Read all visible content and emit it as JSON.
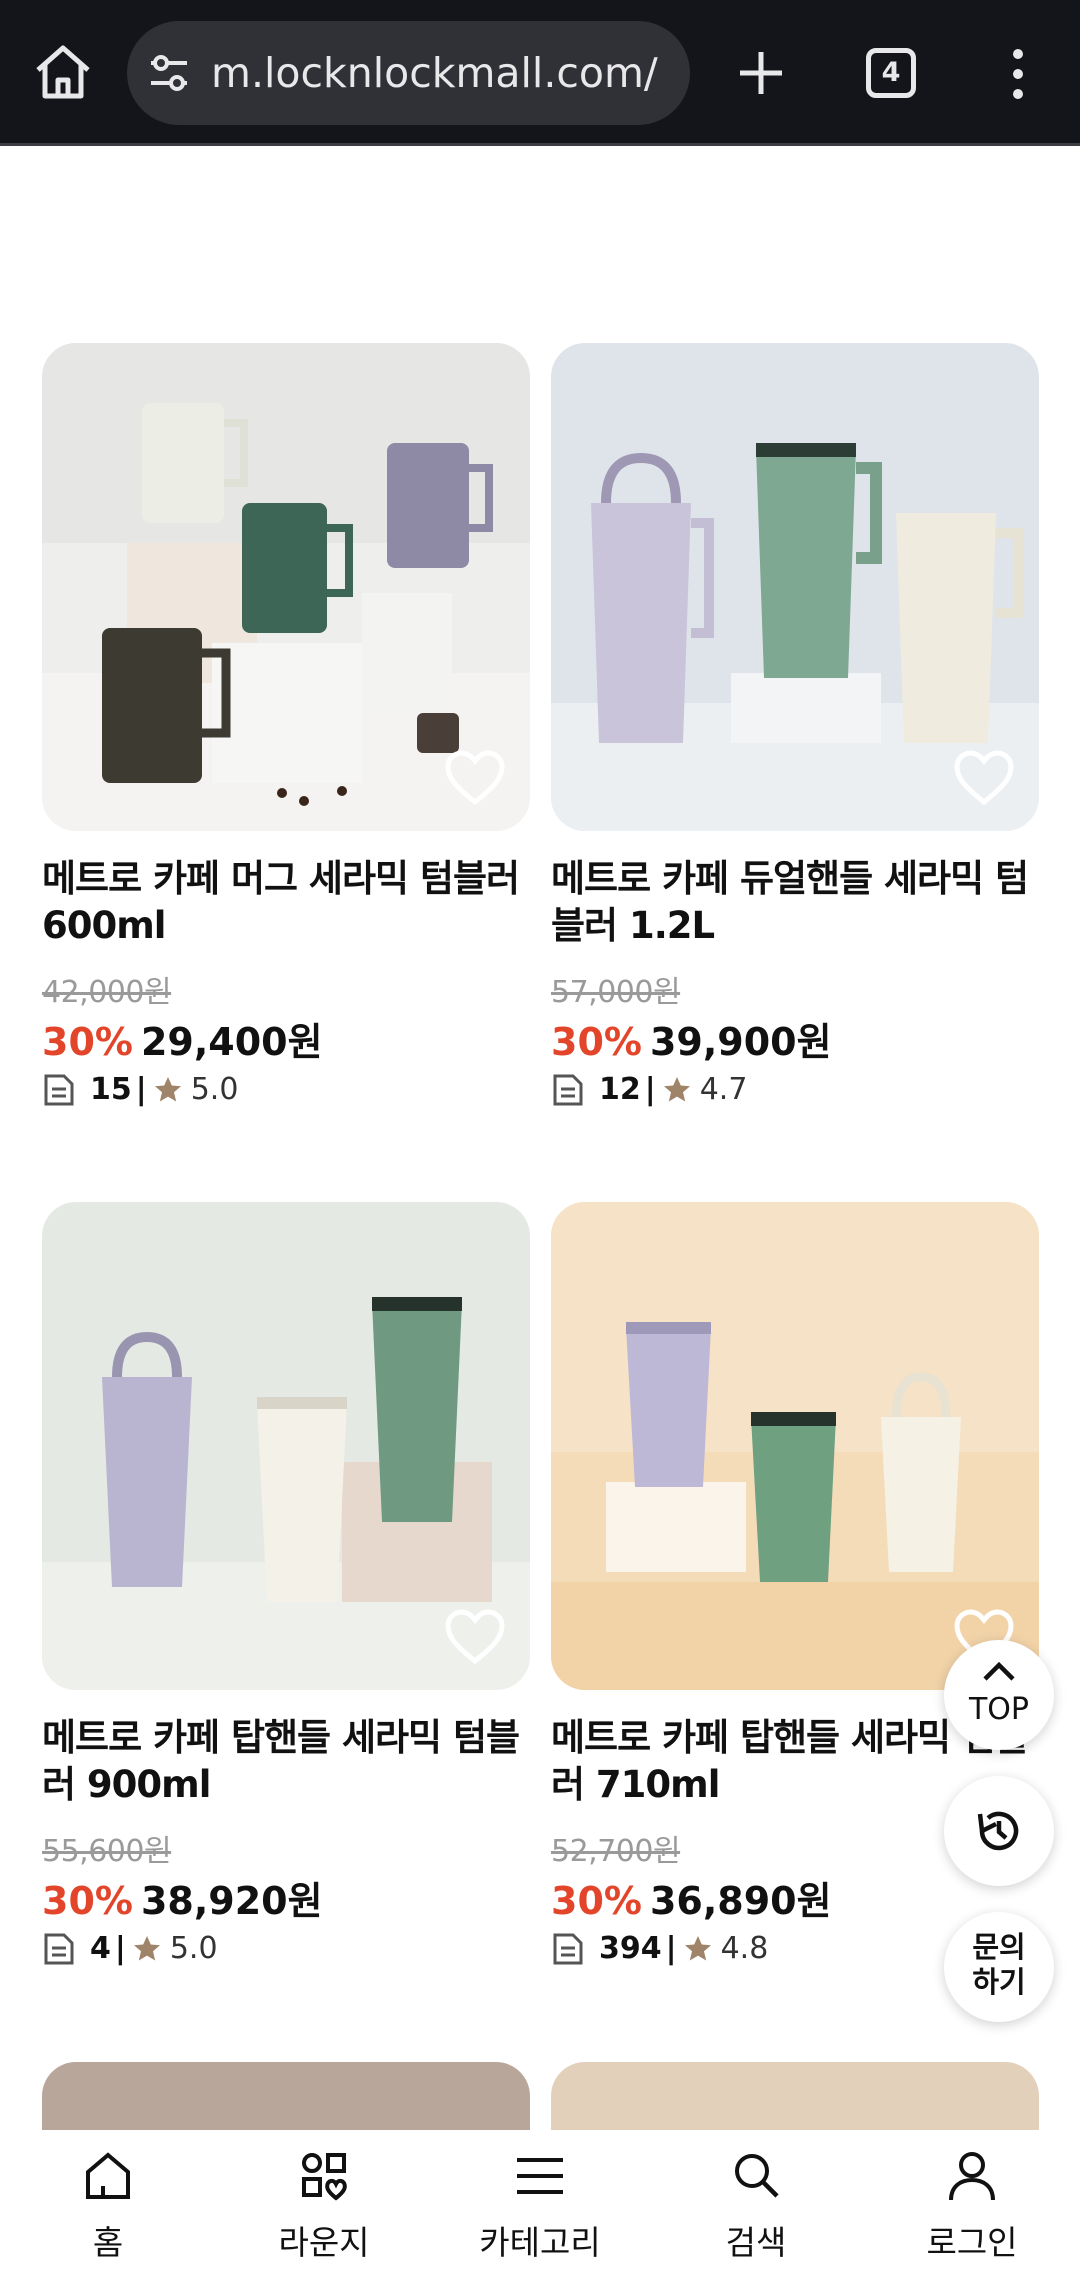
{
  "browser": {
    "url": "m.locknlockmall.com/",
    "tab_count": "4",
    "icons": [
      "home-icon",
      "tune-icon",
      "plus-icon",
      "tab-switcher-icon",
      "more-vert-icon"
    ]
  },
  "products": [
    {
      "name": "메트로 카페 머그 세라믹 텀블러 600ml",
      "original_price": "42,000원",
      "discount": "30%",
      "sale_price": "29,400원",
      "review_count": "15",
      "rating": "5.0"
    },
    {
      "name": "메트로 카페 듀얼핸들 세라믹 텀블러 1.2L",
      "original_price": "57,000원",
      "discount": "30%",
      "sale_price": "39,900원",
      "review_count": "12",
      "rating": "4.7"
    },
    {
      "name": "메트로 카페 탑핸들 세라믹 텀블러 900ml",
      "original_price": "55,600원",
      "discount": "30%",
      "sale_price": "38,920원",
      "review_count": "4",
      "rating": "5.0"
    },
    {
      "name": "메트로 카페 탑핸들 세라믹 텀블러 710ml",
      "original_price": "52,700원",
      "discount": "30%",
      "sale_price": "36,890원",
      "review_count": "394",
      "rating": "4.8"
    }
  ],
  "review_separator": "|",
  "floating": {
    "top_label": "TOP",
    "inquiry_line1": "문의",
    "inquiry_line2": "하기"
  },
  "bottom_nav": [
    {
      "label": "홈",
      "icon": "home-icon"
    },
    {
      "label": "라운지",
      "icon": "lounge-icon"
    },
    {
      "label": "카테고리",
      "icon": "menu-icon"
    },
    {
      "label": "검색",
      "icon": "search-icon"
    },
    {
      "label": "로그인",
      "icon": "user-icon"
    }
  ],
  "colors": {
    "discount": "#e3452b",
    "browser_bar": "#13151a",
    "star": "#a0846a"
  }
}
